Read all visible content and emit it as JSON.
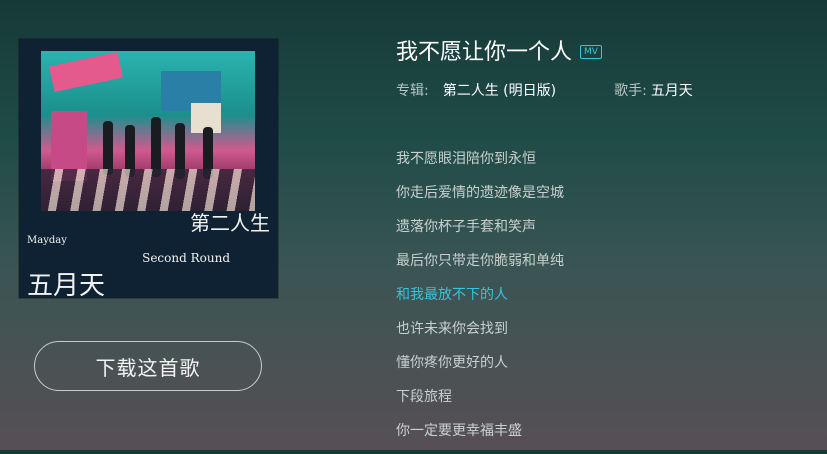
{
  "album_art": {
    "cover_text_line1": "Mayday",
    "cover_text_line2": "第二人生",
    "cover_text_line3": "Second Round",
    "cover_text_line4": "五月天"
  },
  "download_button": {
    "label": "下载这首歌"
  },
  "song": {
    "title": "我不愿让你一个人",
    "mv_badge": "MV",
    "album_label": "专辑:",
    "album_name": "第二人生 (明日版)",
    "singer_label": "歌手:",
    "singer_name": "五月天"
  },
  "lyrics": [
    {
      "text": "我不愿眼泪陪你到永恒",
      "active": false
    },
    {
      "text": "你走后爱情的遗迹像是空城",
      "active": false
    },
    {
      "text": "遗落你杯子手套和笑声",
      "active": false
    },
    {
      "text": "最后你只带走你脆弱和单纯",
      "active": false
    },
    {
      "text": "和我最放不下的人",
      "active": true
    },
    {
      "text": "也许未来你会找到",
      "active": false
    },
    {
      "text": "懂你疼你更好的人",
      "active": false
    },
    {
      "text": "下段旅程",
      "active": false
    },
    {
      "text": "你一定要更幸福丰盛",
      "active": false
    }
  ],
  "colors": {
    "accent": "#37c3db",
    "lyric_normal": "#c8d1cf",
    "bg_top": "#163a38",
    "bg_bottom": "#574f55"
  }
}
